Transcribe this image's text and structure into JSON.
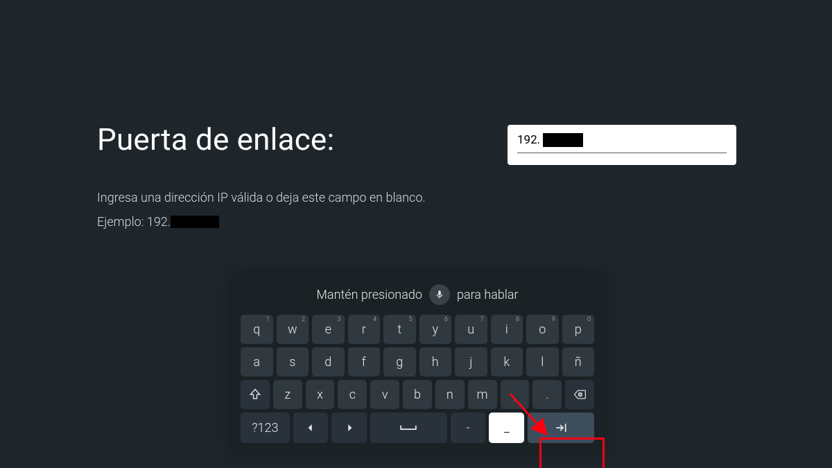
{
  "title": "Puerta de enlace:",
  "help_line1": "Ingresa una dirección IP válida o deja este campo en blanco.",
  "example_prefix": "Ejemplo: 192.",
  "input": {
    "value_prefix": "192."
  },
  "keyboard": {
    "hint_left": "Mantén presionado",
    "hint_right": "para hablar",
    "row1": [
      {
        "k": "q",
        "s": "1"
      },
      {
        "k": "w",
        "s": "2"
      },
      {
        "k": "e",
        "s": "3"
      },
      {
        "k": "r",
        "s": "4"
      },
      {
        "k": "t",
        "s": "5"
      },
      {
        "k": "y",
        "s": "6"
      },
      {
        "k": "u",
        "s": "7"
      },
      {
        "k": "i",
        "s": "8"
      },
      {
        "k": "o",
        "s": "9"
      },
      {
        "k": "p",
        "s": "0"
      }
    ],
    "row2": [
      "a",
      "s",
      "d",
      "f",
      "g",
      "h",
      "j",
      "k",
      "l",
      "ñ"
    ],
    "row3": [
      "z",
      "x",
      "c",
      "v",
      "b",
      "n",
      "m",
      ",",
      "."
    ],
    "symbols_label": "?123",
    "dash_label": "-",
    "underscore_label": "_"
  }
}
